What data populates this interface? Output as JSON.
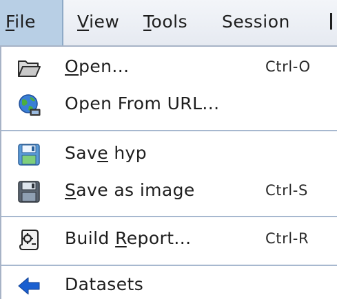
{
  "menubar": {
    "items": [
      {
        "pre": "",
        "acc": "F",
        "post": "ile"
      },
      {
        "pre": "",
        "acc": "V",
        "post": "iew"
      },
      {
        "pre": "",
        "acc": "T",
        "post": "ools"
      },
      {
        "pre": "Session",
        "acc": "",
        "post": ""
      },
      {
        "pre": "",
        "acc": "",
        "post": ""
      }
    ]
  },
  "file_menu": {
    "items": [
      {
        "pre": "",
        "acc": "O",
        "post": "pen...",
        "shortcut": "Ctrl-O",
        "icon": "folder-open-icon"
      },
      {
        "pre": "Open From URL...",
        "acc": "",
        "post": "",
        "shortcut": "",
        "icon": "globe-network-icon"
      },
      {
        "pre": "Sav",
        "acc": "e",
        "post": " hyp",
        "shortcut": "",
        "icon": "floppy-disk-icon"
      },
      {
        "pre": "",
        "acc": "S",
        "post": "ave as image",
        "shortcut": "Ctrl-S",
        "icon": "floppy-disk-dark-icon"
      },
      {
        "pre": "Build ",
        "acc": "R",
        "post": "eport...",
        "shortcut": "Ctrl-R",
        "icon": "report-scroll-icon"
      },
      {
        "pre": "Datasets",
        "acc": "",
        "post": "",
        "shortcut": "",
        "icon": "back-arrow-icon"
      }
    ]
  },
  "colors": {
    "menubar_active": "#b8cfe5",
    "separator": "#a7b8cf",
    "arrow_blue": "#1a5fd0"
  }
}
